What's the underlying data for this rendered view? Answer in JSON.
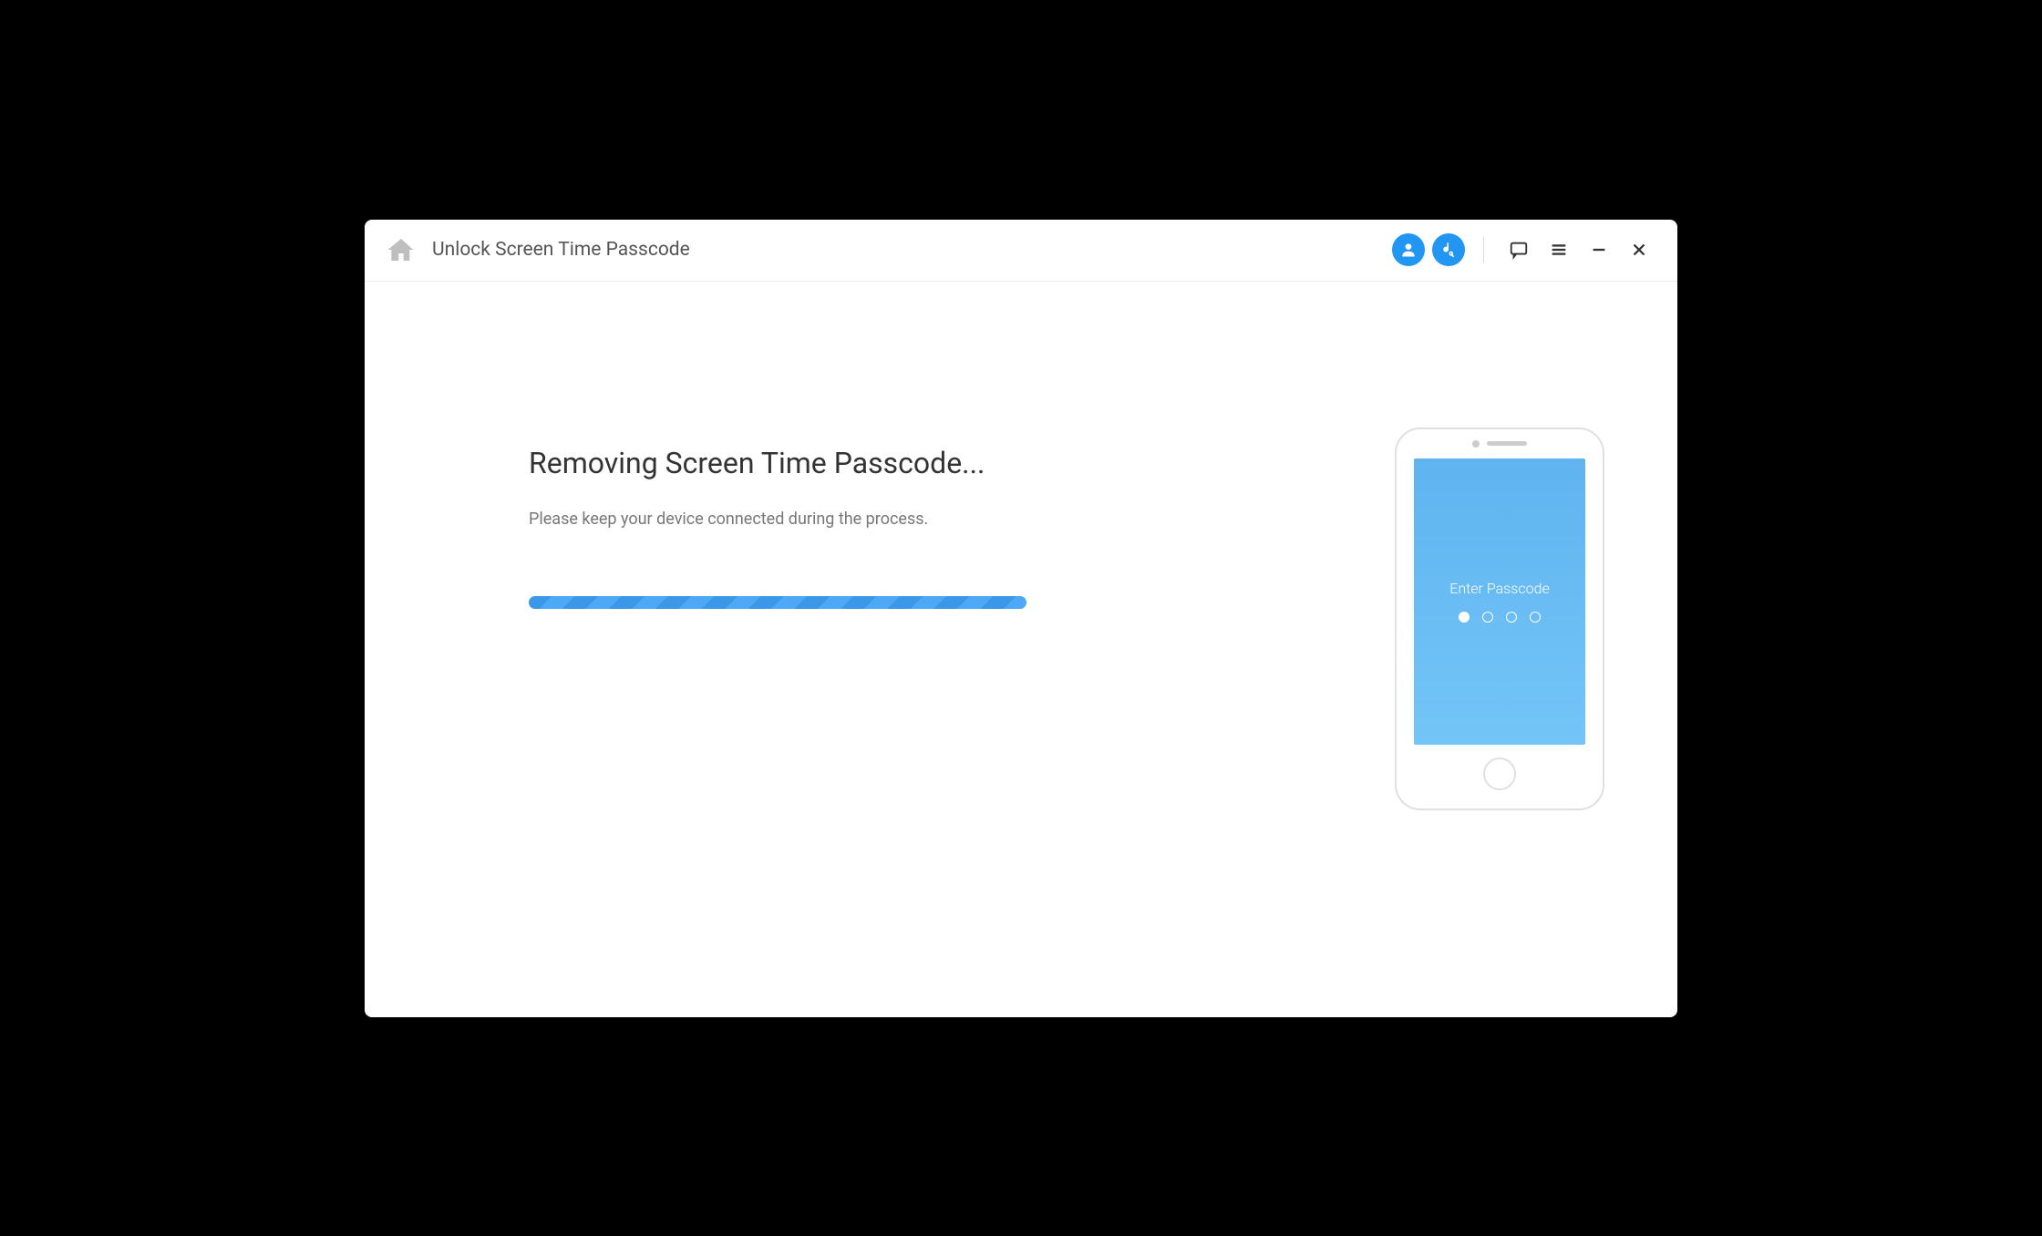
{
  "titlebar": {
    "title": "Unlock Screen Time Passcode"
  },
  "content": {
    "heading": "Removing Screen Time Passcode...",
    "subtext": "Please keep your device connected during the process."
  },
  "phone": {
    "passcode_label": "Enter Passcode"
  }
}
